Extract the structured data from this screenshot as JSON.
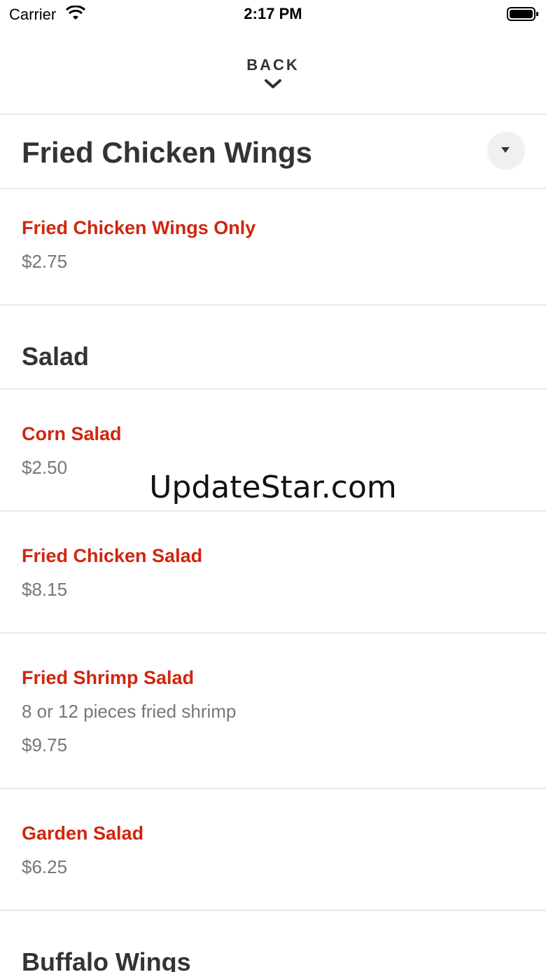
{
  "status_bar": {
    "carrier": "Carrier",
    "time": "2:17 PM"
  },
  "nav": {
    "back_label": "BACK"
  },
  "sections": {
    "fried_chicken_wings": {
      "title": "Fried Chicken Wings",
      "items": [
        {
          "name": "Fried Chicken Wings Only",
          "price": "$2.75"
        }
      ]
    },
    "salad": {
      "title": "Salad",
      "items": [
        {
          "name": "Corn Salad",
          "price": "$2.50"
        },
        {
          "name": "Fried Chicken Salad",
          "price": "$8.15"
        },
        {
          "name": "Fried Shrimp Salad",
          "description": "8 or 12 pieces fried shrimp",
          "price": "$9.75"
        },
        {
          "name": "Garden Salad",
          "price": "$6.25"
        }
      ]
    },
    "buffalo_wings": {
      "title": "Buffalo Wings"
    }
  },
  "watermark": "UpdateStar.com",
  "colors": {
    "item_name": "#d0260e",
    "secondary_text": "#777777",
    "heading": "#333333",
    "divider": "#e8e8e8"
  },
  "icons": {
    "wifi": "wifi-icon",
    "battery": "battery-icon",
    "back": "chevron-down-icon",
    "collapse": "caret-down-icon"
  }
}
